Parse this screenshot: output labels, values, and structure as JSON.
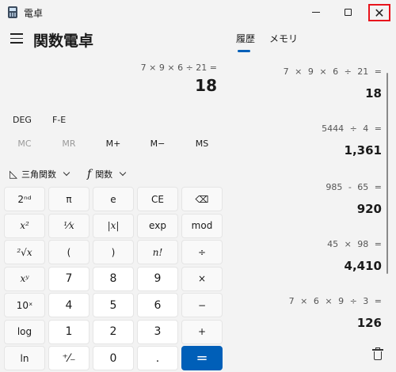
{
  "window": {
    "title": "電卓",
    "close_symbol": "✕"
  },
  "header": {
    "mode_title": "関数電卓"
  },
  "display": {
    "expression": "7 × 9 × 6 ÷ 21 =",
    "result": "18"
  },
  "modes": {
    "angle": "DEG",
    "fe": "F-E"
  },
  "memory_buttons": [
    {
      "label": "MC",
      "enabled": false
    },
    {
      "label": "MR",
      "enabled": false
    },
    {
      "label": "M+",
      "enabled": true
    },
    {
      "label": "M−",
      "enabled": true
    },
    {
      "label": "MS",
      "enabled": true
    }
  ],
  "functions": {
    "trig_label": "三角関数",
    "func_label": "関数",
    "func_icon": "f"
  },
  "keypad": [
    {
      "label": "2ⁿᵈ",
      "kind": "fn",
      "name": "second-key"
    },
    {
      "label": "π",
      "kind": "fn",
      "name": "pi-key"
    },
    {
      "label": "e",
      "kind": "fn",
      "name": "e-key"
    },
    {
      "label": "CE",
      "kind": "fn",
      "name": "clear-entry-key"
    },
    {
      "label": "⌫",
      "kind": "fn",
      "name": "backspace-key"
    },
    {
      "label": "x²",
      "kind": "fn serif",
      "name": "square-key"
    },
    {
      "label": "¹⁄x",
      "kind": "fn serif",
      "name": "reciprocal-key"
    },
    {
      "label": "|x|",
      "kind": "fn serif",
      "name": "absolute-key"
    },
    {
      "label": "exp",
      "kind": "fn",
      "name": "exp-key"
    },
    {
      "label": "mod",
      "kind": "fn",
      "name": "mod-key"
    },
    {
      "label": "²√x",
      "kind": "fn serif",
      "name": "sqrt-key"
    },
    {
      "label": "(",
      "kind": "fn",
      "name": "open-paren-key"
    },
    {
      "label": ")",
      "kind": "fn",
      "name": "close-paren-key"
    },
    {
      "label": "n!",
      "kind": "fn serif",
      "name": "factorial-key"
    },
    {
      "label": "÷",
      "kind": "fn",
      "name": "divide-key"
    },
    {
      "label": "xʸ",
      "kind": "fn serif",
      "name": "power-key"
    },
    {
      "label": "7",
      "kind": "num",
      "name": "digit-7-key"
    },
    {
      "label": "8",
      "kind": "num",
      "name": "digit-8-key"
    },
    {
      "label": "9",
      "kind": "num",
      "name": "digit-9-key"
    },
    {
      "label": "×",
      "kind": "fn",
      "name": "multiply-key"
    },
    {
      "label": "10ˣ",
      "kind": "fn",
      "name": "ten-power-key"
    },
    {
      "label": "4",
      "kind": "num",
      "name": "digit-4-key"
    },
    {
      "label": "5",
      "kind": "num",
      "name": "digit-5-key"
    },
    {
      "label": "6",
      "kind": "num",
      "name": "digit-6-key"
    },
    {
      "label": "−",
      "kind": "fn",
      "name": "minus-key"
    },
    {
      "label": "log",
      "kind": "fn",
      "name": "log-key"
    },
    {
      "label": "1",
      "kind": "num",
      "name": "digit-1-key"
    },
    {
      "label": "2",
      "kind": "num",
      "name": "digit-2-key"
    },
    {
      "label": "3",
      "kind": "num",
      "name": "digit-3-key"
    },
    {
      "label": "+",
      "kind": "fn",
      "name": "plus-key"
    },
    {
      "label": "ln",
      "kind": "fn",
      "name": "ln-key"
    },
    {
      "label": "⁺⁄₋",
      "kind": "num",
      "name": "negate-key"
    },
    {
      "label": "0",
      "kind": "num",
      "name": "digit-0-key"
    },
    {
      "label": ".",
      "kind": "num",
      "name": "decimal-key"
    },
    {
      "label": "=",
      "kind": "eq",
      "name": "equals-key"
    }
  ],
  "history_panel": {
    "tabs": [
      "履歴",
      "メモリ"
    ],
    "active_tab": "履歴",
    "items": [
      {
        "expression": "7 × 9 × 6 ÷ 21 =",
        "result": "18"
      },
      {
        "expression": "5444 ÷ 4 =",
        "result": "1,361"
      },
      {
        "expression": "985 - 65 =",
        "result": "920"
      },
      {
        "expression": "45 × 98 =",
        "result": "4,410"
      },
      {
        "expression": "7 × 6 × 9 ÷ 3 =",
        "result": "126"
      }
    ]
  },
  "colors": {
    "accent": "#005fb8",
    "close_highlight": "#e8141c",
    "background": "#f3f3f3"
  }
}
